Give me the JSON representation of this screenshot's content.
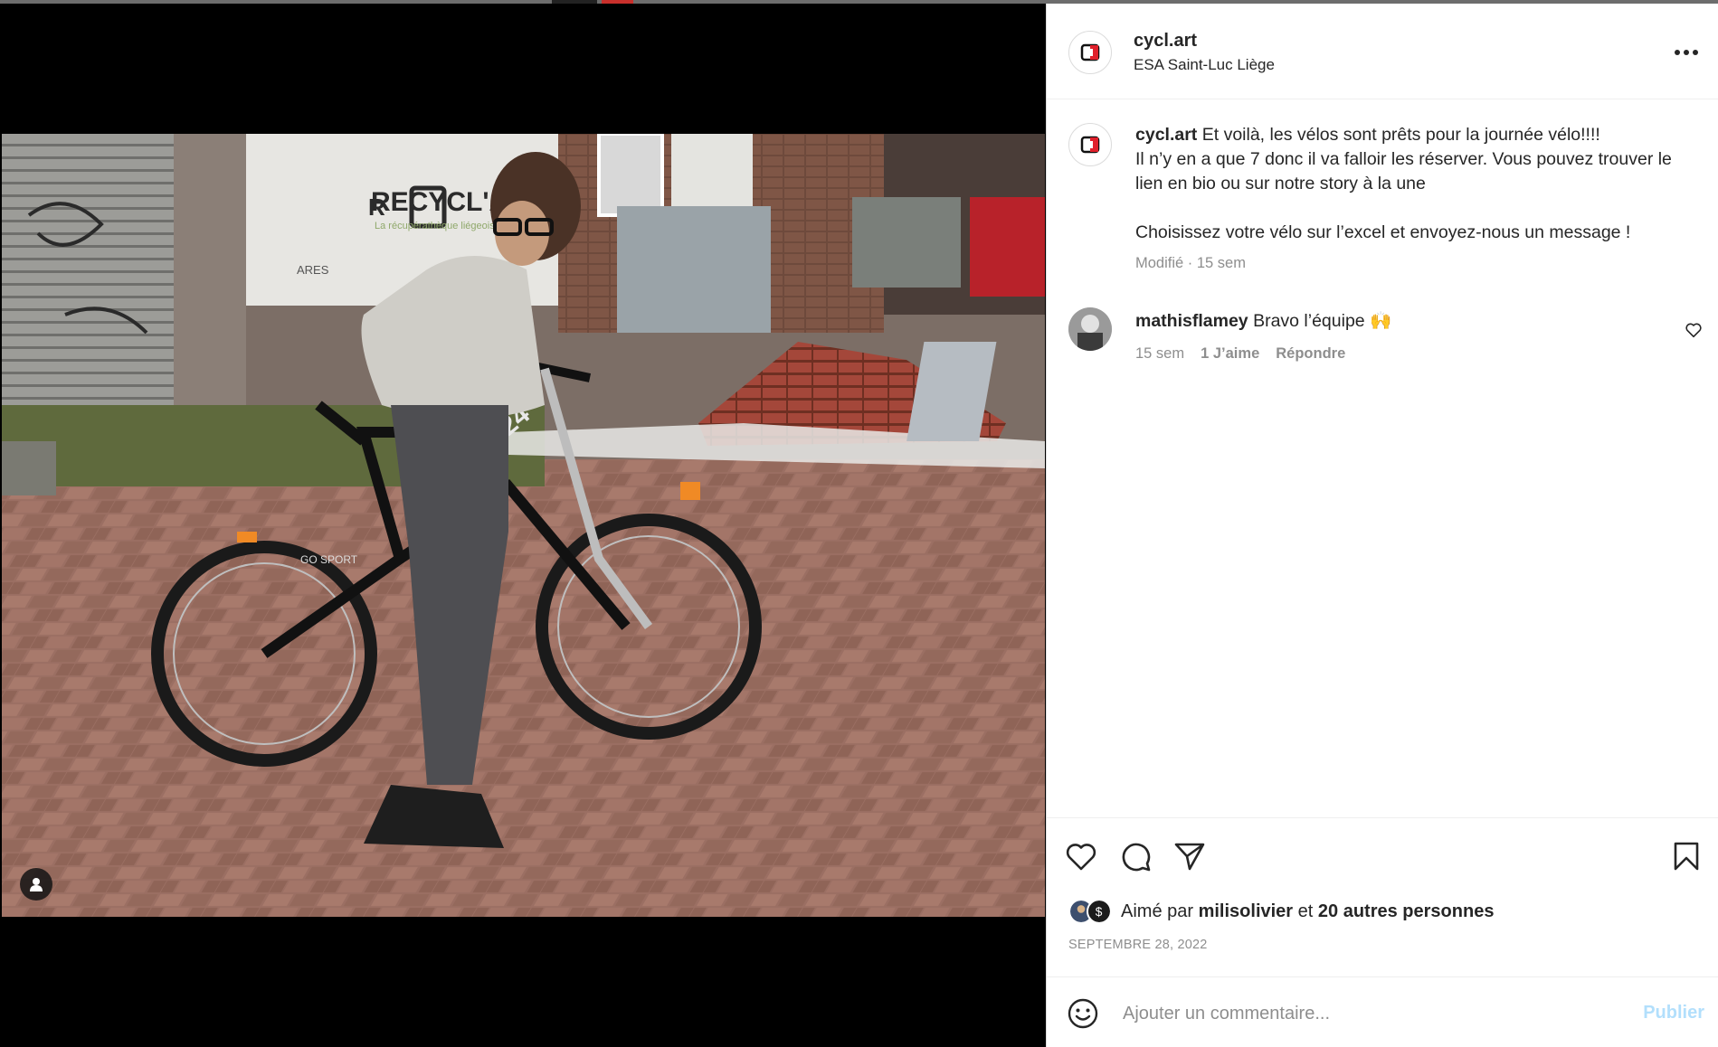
{
  "post": {
    "username": "cycl.art",
    "location": "ESA Saint-Luc Liège"
  },
  "caption": {
    "username": "cycl.art",
    "text_line1": "Et voilà, les vélos sont prêts pour la journée vélo!!!!",
    "text_line2": "Il n’y en a que 7 donc il va falloir les réserver. Vous pouvez trouver le lien en bio ou sur notre story à la une",
    "text_line3": "Choisissez votre vélo sur l’excel et envoyez-nous un message !",
    "meta": "Modifié · 15 sem"
  },
  "comment": {
    "username": "mathisflamey",
    "text": "Bravo l’équipe 🙌",
    "age": "15 sem",
    "likes": "1 J’aime",
    "reply": "Répondre"
  },
  "likes": {
    "prefix": "Aimé par",
    "user": "milisolivier",
    "conjunction": "et",
    "others": "20 autres personnes"
  },
  "date": "SEPTEMBRE 28, 2022",
  "comment_box": {
    "placeholder": "Ajouter un commentaire...",
    "publish_label": "Publier"
  },
  "photo": {
    "banner_text": "RECYCL'Art",
    "banner_sub": "La récupérathèque liégeoise",
    "banner_brand": "ARES",
    "bike_text": "GO SPORT",
    "bike_number": "24"
  },
  "icons": {
    "more": "more-horizontal-icon",
    "like": "heart-icon",
    "comment": "comment-icon",
    "share": "paper-plane-icon",
    "save": "bookmark-icon",
    "emoji": "smiley-icon",
    "user_tag": "user-tag-icon"
  },
  "colors": {
    "accent_disabled": "#b2dffc",
    "text": "#262626",
    "muted": "#8e8e8e",
    "logo_red": "#e0202b"
  }
}
